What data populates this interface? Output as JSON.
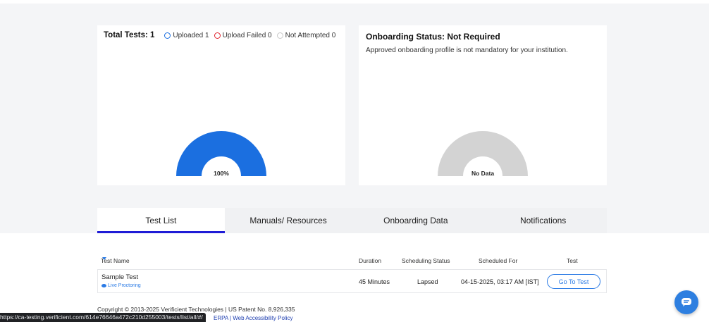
{
  "summary": {
    "total_label": "Total Tests: 1",
    "legend": [
      {
        "label": "Uploaded 1",
        "color": "#1b6fe0"
      },
      {
        "label": "Upload Failed 0",
        "color": "#e0242f"
      },
      {
        "label": "Not Attempted 0",
        "color": "#c8c8c8"
      }
    ],
    "gauge_label": "100%",
    "gauge_color": "#1b6fe0"
  },
  "onboarding": {
    "title": "Onboarding Status: Not Required",
    "description": "Approved onboarding profile is not mandatory for your institution.",
    "gauge_label": "No Data",
    "gauge_color": "#d3d3d3"
  },
  "tabs": [
    {
      "label": "Test List",
      "active": true
    },
    {
      "label": "Manuals/ Resources",
      "active": false
    },
    {
      "label": "Onboarding Data",
      "active": false
    },
    {
      "label": "Notifications",
      "active": false
    }
  ],
  "table": {
    "headers": {
      "name": "Test Name",
      "duration": "Duration",
      "status": "Scheduling Status",
      "scheduled": "Scheduled For",
      "test": "Test"
    },
    "rows": [
      {
        "name": "Sample Test",
        "proctoring": "Live Proctoring",
        "duration": "45 Minutes",
        "status": "Lapsed",
        "scheduled": "04-15-2025, 03:17 AM [IST]",
        "action": "Go To Test"
      }
    ]
  },
  "footer": {
    "copyright": "Copyright © 2013-2025 Verificient Technologies | US Patent No. 8,926,335",
    "links": "ERPA | Web Accessibility Policy",
    "status_url": "https://ca-testing.verificient.com/614e76646a472c210d255003/tests/list/all/#/"
  },
  "colors": {
    "accent": "#2b7be5",
    "tab_underline": "#1f1cd6"
  },
  "icons": {
    "chat": "chat-bubble-icon",
    "eye": "eye-icon",
    "sort": "caret-down-icon"
  }
}
